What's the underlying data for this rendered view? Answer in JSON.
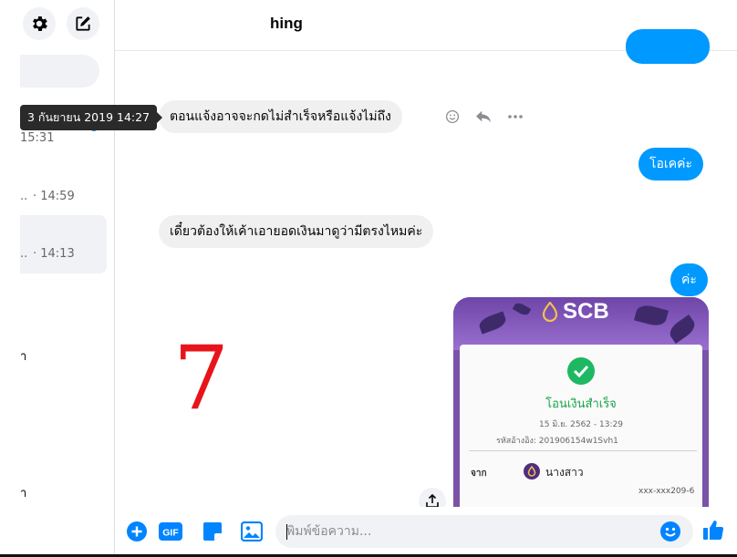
{
  "header": {
    "title": "hing"
  },
  "sidebar": {
    "items": [
      {
        "time": "15:31"
      },
      {
        "time": "· 14:59",
        "prefix": ".."
      },
      {
        "time": "· 14:13",
        "prefix": ".."
      }
    ],
    "fragments": [
      "า",
      "า"
    ]
  },
  "tooltip": {
    "text": "3 กันยายน 2019 14:27"
  },
  "messages": [
    {
      "direction": "in",
      "text": "ตอนแจ้งอาจจะกดไม่สำเร็จหรือแจ้งไม่ถึง"
    },
    {
      "direction": "out",
      "text": "โอเคค่ะ"
    },
    {
      "direction": "in",
      "text": "เดี๋ยวต้องให้เค้าเอายอดเงินมาดูว่ามีตรงไหมค่ะ"
    },
    {
      "direction": "out",
      "text": "ค่ะ"
    }
  ],
  "overlay": {
    "number": "7"
  },
  "receipt": {
    "brand": "SCB",
    "status": "โอนเงินสำเร็จ",
    "date": "15 มิ.ย. 2562 - 13:29",
    "reference": "รหัสอ้างอิง: 201906154w1Svh1",
    "from_label": "จาก",
    "from_name": "นางสาว",
    "account": "xxx-xxx209-6"
  },
  "composer": {
    "placeholder": "พิมพ์ข้อความ..."
  },
  "icons": {
    "settings": "gear-icon",
    "compose": "compose-icon",
    "emoji_react": "smiley-icon",
    "reply": "reply-icon",
    "more": "more-icon",
    "plus": "plus-icon",
    "gif": "gif-icon",
    "sticker": "sticker-icon",
    "photo": "image-icon",
    "emoji": "emoji-icon",
    "like": "thumbs-up-icon",
    "share": "share-icon"
  },
  "colors": {
    "accent": "#0099ff",
    "incoming_bubble": "#f0f0f0",
    "seven": "#e8141b",
    "scb_purple": "#4f2d7f",
    "success_green": "#1eb863"
  }
}
